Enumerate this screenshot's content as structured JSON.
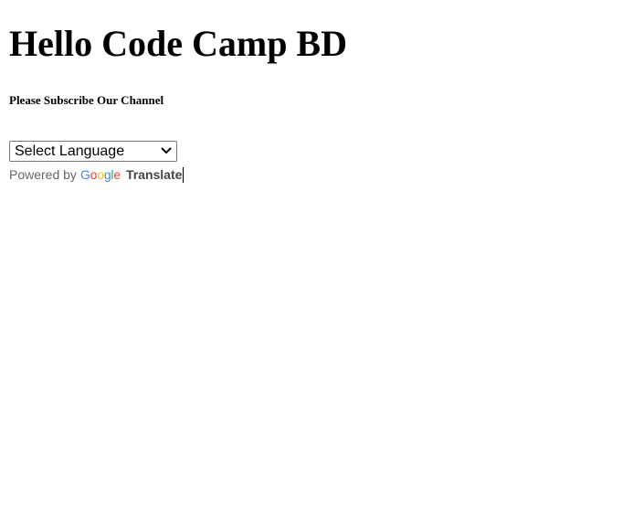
{
  "page": {
    "heading": "Hello Code Camp BD",
    "subheading": "Please Subscribe Our Channel"
  },
  "translate_widget": {
    "select_value": "Select Language",
    "powered_by_label": "Powered by",
    "google_logo_text": "Google",
    "google_logo_letters": [
      {
        "char": "G",
        "color": "#4285F4"
      },
      {
        "char": "o",
        "color": "#EA4335"
      },
      {
        "char": "o",
        "color": "#FBBC05"
      },
      {
        "char": "g",
        "color": "#4285F4"
      },
      {
        "char": "l",
        "color": "#34A853"
      },
      {
        "char": "e",
        "color": "#EA4335"
      }
    ],
    "translate_link": "Translate"
  },
  "icons": {
    "dropdown": "chevron-down-icon"
  }
}
